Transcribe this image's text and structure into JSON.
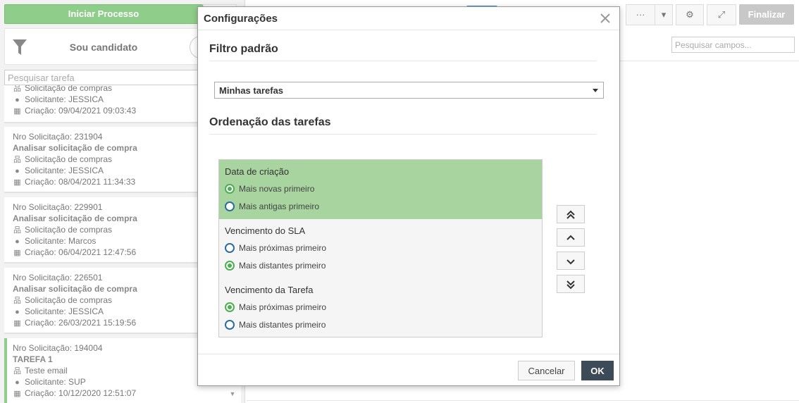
{
  "left_panel": {
    "start_button": "Iniciar Processo",
    "filter_label": "Sou candidato",
    "task_search_placeholder": "Pesquisar tarefa",
    "tasks": [
      {
        "number": "",
        "title": "",
        "process": "Solicitação de compras",
        "requester": "Solicitante: JESSICA",
        "created": "Criação: 09/04/2021 09:03:43"
      },
      {
        "number": "Nro Solicitação: 231904",
        "title": "Analisar solicitação de compra",
        "process": "Solicitação de compras",
        "requester": "Solicitante: JESSICA",
        "created": "Criação: 08/04/2021 11:34:33"
      },
      {
        "number": "Nro Solicitação: 229901",
        "title": "Analisar solicitação de compra",
        "process": "Solicitação de compras",
        "requester": "Solicitante: Marcos",
        "created": "Criação: 06/04/2021 12:47:56"
      },
      {
        "number": "Nro Solicitação: 226501",
        "title": "Analisar solicitação de compra",
        "process": "Solicitação de compras",
        "requester": "Solicitante: JESSICA",
        "created": "Criação: 26/03/2021 15:19:56"
      },
      {
        "number": "Nro Solicitação: 194004",
        "title": "TAREFA 1",
        "process": "Teste email",
        "requester": "Solicitante: SUP",
        "created": "Criação: 10/12/2020 12:51:07"
      }
    ]
  },
  "toolbar": {
    "more_label": "···",
    "finalize_button": "Finalizar",
    "fields_search_placeholder": "Pesquisar campos..."
  },
  "modal": {
    "title": "Configurações",
    "default_filter_title": "Filtro padrão",
    "default_filter_value": "Minhas tarefas",
    "ordering_title": "Ordenação das tarefas",
    "groups": [
      {
        "title": "Data de criação",
        "options": [
          "Mais novas primeiro",
          "Mais antigas primeiro"
        ],
        "checked": 0,
        "selected": true
      },
      {
        "title": "Vencimento do SLA",
        "options": [
          "Mais próximas primeiro",
          "Mais distantes primeiro"
        ],
        "checked": 1,
        "selected": false
      },
      {
        "title": "Vencimento da Tarefa",
        "options": [
          "Mais próximas primeiro",
          "Mais distantes primeiro"
        ],
        "checked": 0,
        "selected": false
      }
    ],
    "cancel_button": "Cancelar",
    "ok_button": "OK"
  },
  "colors": {
    "accent_green": "#8fce8a",
    "selected_row_green": "#a8d49f",
    "radio_checked": "#4caf50",
    "radio_unchecked": "#2b6d9c",
    "ok_button_bg": "#3d4a57"
  }
}
